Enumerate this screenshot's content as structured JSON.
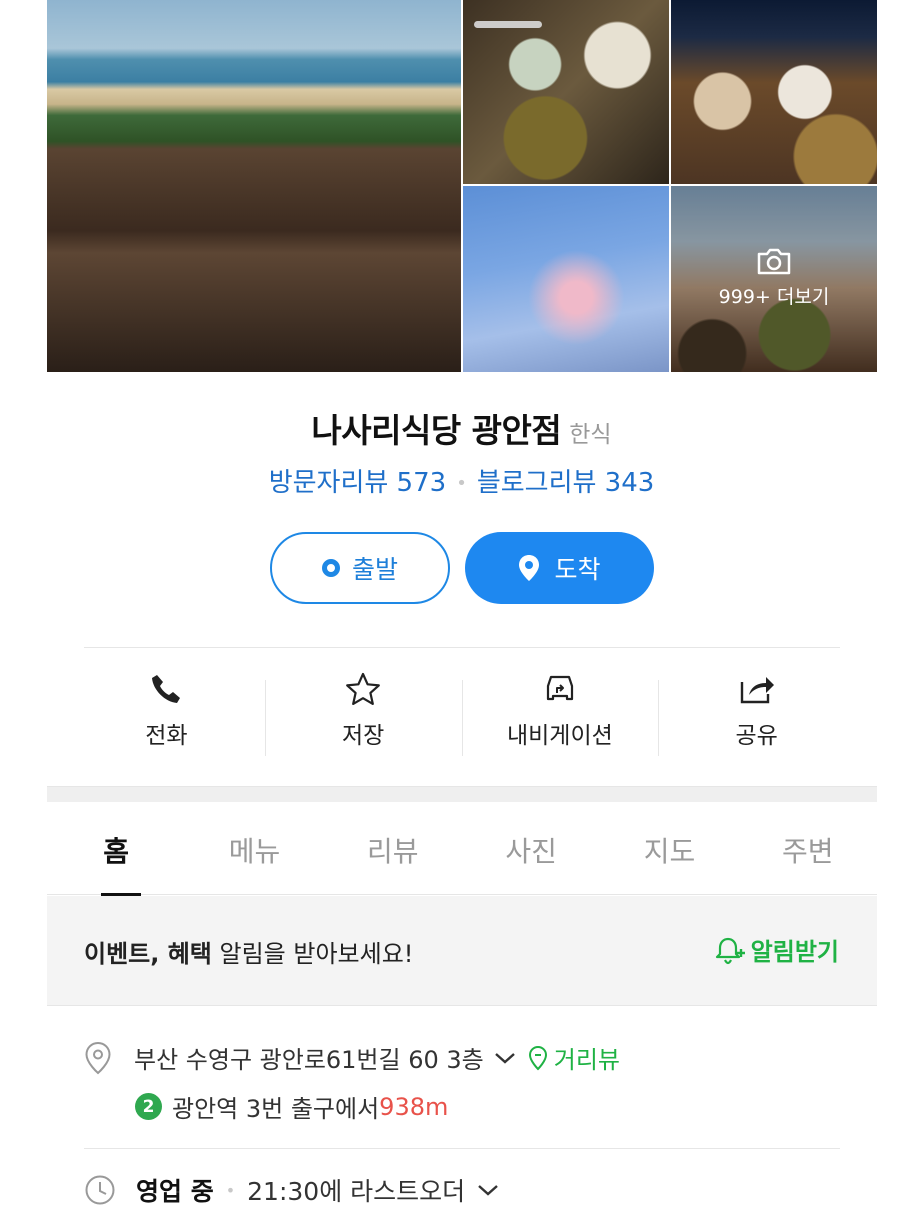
{
  "gallery": {
    "more_label": "999+ 더보기"
  },
  "place": {
    "name": "나사리식당 광안점",
    "category": "한식"
  },
  "reviews": {
    "visitor_label": "방문자리뷰 573",
    "blog_label": "블로그리뷰 343"
  },
  "route": {
    "start_label": "출발",
    "arrive_label": "도착"
  },
  "actions": [
    {
      "label": "전화",
      "icon": "phone-icon"
    },
    {
      "label": "저장",
      "icon": "star-icon"
    },
    {
      "label": "내비게이션",
      "icon": "car-navigation-icon"
    },
    {
      "label": "공유",
      "icon": "share-icon"
    }
  ],
  "tabs": [
    {
      "label": "홈",
      "active": true
    },
    {
      "label": "메뉴",
      "active": false
    },
    {
      "label": "리뷰",
      "active": false
    },
    {
      "label": "사진",
      "active": false
    },
    {
      "label": "지도",
      "active": false
    },
    {
      "label": "주변",
      "active": false
    }
  ],
  "event": {
    "bold_text": "이벤트, 혜택",
    "rest_text": " 알림을 받아보세요!",
    "button_label": "알림받기"
  },
  "address": {
    "text": "부산 수영구 광안로61번길 60 3층",
    "street_view_label": "거리뷰"
  },
  "station": {
    "line_number": "2",
    "text": "광안역 3번 출구에서 ",
    "distance": "938m"
  },
  "hours": {
    "status": "영업 중",
    "last_order": "21:30에 라스트오더"
  },
  "colors": {
    "primary_blue": "#1e88f0",
    "link_blue": "#1f6fc9",
    "green": "#1fb244",
    "distance_red": "#e8524a",
    "line2_green": "#2fa84f"
  }
}
